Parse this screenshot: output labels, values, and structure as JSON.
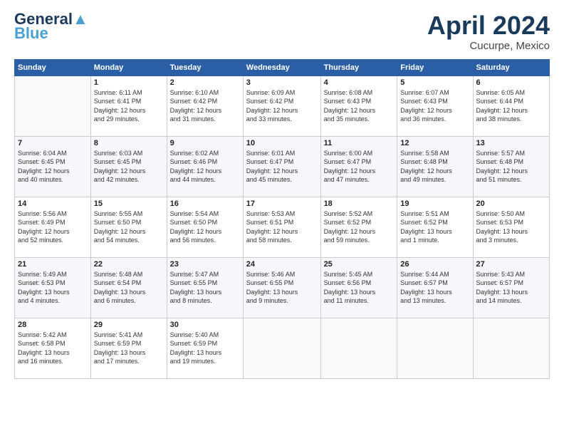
{
  "logo": {
    "line1": "General",
    "line2": "Blue"
  },
  "title": "April 2024",
  "location": "Cucurpe, Mexico",
  "weekdays": [
    "Sunday",
    "Monday",
    "Tuesday",
    "Wednesday",
    "Thursday",
    "Friday",
    "Saturday"
  ],
  "weeks": [
    [
      {
        "day": "",
        "info": ""
      },
      {
        "day": "1",
        "info": "Sunrise: 6:11 AM\nSunset: 6:41 PM\nDaylight: 12 hours\nand 29 minutes."
      },
      {
        "day": "2",
        "info": "Sunrise: 6:10 AM\nSunset: 6:42 PM\nDaylight: 12 hours\nand 31 minutes."
      },
      {
        "day": "3",
        "info": "Sunrise: 6:09 AM\nSunset: 6:42 PM\nDaylight: 12 hours\nand 33 minutes."
      },
      {
        "day": "4",
        "info": "Sunrise: 6:08 AM\nSunset: 6:43 PM\nDaylight: 12 hours\nand 35 minutes."
      },
      {
        "day": "5",
        "info": "Sunrise: 6:07 AM\nSunset: 6:43 PM\nDaylight: 12 hours\nand 36 minutes."
      },
      {
        "day": "6",
        "info": "Sunrise: 6:05 AM\nSunset: 6:44 PM\nDaylight: 12 hours\nand 38 minutes."
      }
    ],
    [
      {
        "day": "7",
        "info": "Sunrise: 6:04 AM\nSunset: 6:45 PM\nDaylight: 12 hours\nand 40 minutes."
      },
      {
        "day": "8",
        "info": "Sunrise: 6:03 AM\nSunset: 6:45 PM\nDaylight: 12 hours\nand 42 minutes."
      },
      {
        "day": "9",
        "info": "Sunrise: 6:02 AM\nSunset: 6:46 PM\nDaylight: 12 hours\nand 44 minutes."
      },
      {
        "day": "10",
        "info": "Sunrise: 6:01 AM\nSunset: 6:47 PM\nDaylight: 12 hours\nand 45 minutes."
      },
      {
        "day": "11",
        "info": "Sunrise: 6:00 AM\nSunset: 6:47 PM\nDaylight: 12 hours\nand 47 minutes."
      },
      {
        "day": "12",
        "info": "Sunrise: 5:58 AM\nSunset: 6:48 PM\nDaylight: 12 hours\nand 49 minutes."
      },
      {
        "day": "13",
        "info": "Sunrise: 5:57 AM\nSunset: 6:48 PM\nDaylight: 12 hours\nand 51 minutes."
      }
    ],
    [
      {
        "day": "14",
        "info": "Sunrise: 5:56 AM\nSunset: 6:49 PM\nDaylight: 12 hours\nand 52 minutes."
      },
      {
        "day": "15",
        "info": "Sunrise: 5:55 AM\nSunset: 6:50 PM\nDaylight: 12 hours\nand 54 minutes."
      },
      {
        "day": "16",
        "info": "Sunrise: 5:54 AM\nSunset: 6:50 PM\nDaylight: 12 hours\nand 56 minutes."
      },
      {
        "day": "17",
        "info": "Sunrise: 5:53 AM\nSunset: 6:51 PM\nDaylight: 12 hours\nand 58 minutes."
      },
      {
        "day": "18",
        "info": "Sunrise: 5:52 AM\nSunset: 6:52 PM\nDaylight: 12 hours\nand 59 minutes."
      },
      {
        "day": "19",
        "info": "Sunrise: 5:51 AM\nSunset: 6:52 PM\nDaylight: 13 hours\nand 1 minute."
      },
      {
        "day": "20",
        "info": "Sunrise: 5:50 AM\nSunset: 6:53 PM\nDaylight: 13 hours\nand 3 minutes."
      }
    ],
    [
      {
        "day": "21",
        "info": "Sunrise: 5:49 AM\nSunset: 6:53 PM\nDaylight: 13 hours\nand 4 minutes."
      },
      {
        "day": "22",
        "info": "Sunrise: 5:48 AM\nSunset: 6:54 PM\nDaylight: 13 hours\nand 6 minutes."
      },
      {
        "day": "23",
        "info": "Sunrise: 5:47 AM\nSunset: 6:55 PM\nDaylight: 13 hours\nand 8 minutes."
      },
      {
        "day": "24",
        "info": "Sunrise: 5:46 AM\nSunset: 6:55 PM\nDaylight: 13 hours\nand 9 minutes."
      },
      {
        "day": "25",
        "info": "Sunrise: 5:45 AM\nSunset: 6:56 PM\nDaylight: 13 hours\nand 11 minutes."
      },
      {
        "day": "26",
        "info": "Sunrise: 5:44 AM\nSunset: 6:57 PM\nDaylight: 13 hours\nand 13 minutes."
      },
      {
        "day": "27",
        "info": "Sunrise: 5:43 AM\nSunset: 6:57 PM\nDaylight: 13 hours\nand 14 minutes."
      }
    ],
    [
      {
        "day": "28",
        "info": "Sunrise: 5:42 AM\nSunset: 6:58 PM\nDaylight: 13 hours\nand 16 minutes."
      },
      {
        "day": "29",
        "info": "Sunrise: 5:41 AM\nSunset: 6:59 PM\nDaylight: 13 hours\nand 17 minutes."
      },
      {
        "day": "30",
        "info": "Sunrise: 5:40 AM\nSunset: 6:59 PM\nDaylight: 13 hours\nand 19 minutes."
      },
      {
        "day": "",
        "info": ""
      },
      {
        "day": "",
        "info": ""
      },
      {
        "day": "",
        "info": ""
      },
      {
        "day": "",
        "info": ""
      }
    ]
  ]
}
